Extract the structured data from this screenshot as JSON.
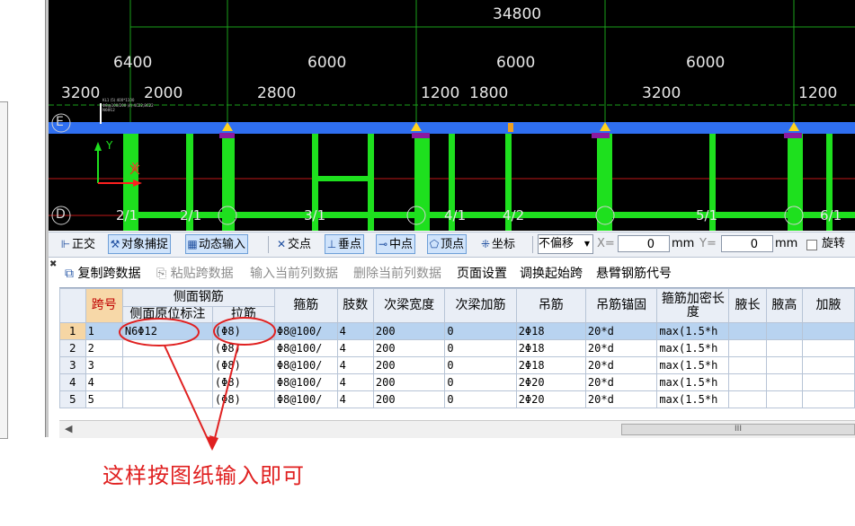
{
  "cad": {
    "total_dim": "34800",
    "upper_dims": [
      "6400",
      "6000",
      "6000",
      "6000"
    ],
    "lower_dims": [
      "3200",
      "2000",
      "2800",
      "1200",
      "1800",
      "3200",
      "1200"
    ],
    "axis_top": "E",
    "axis_bottom": "D",
    "span_labels": [
      "2/1",
      "2/1",
      "3/1",
      "4/1",
      "4/2",
      "5/1",
      "6/1"
    ],
    "ucs_y": "Y",
    "ucs_x": "X",
    "beam_color": "#2f6ff0",
    "rebar_color": "#1ee01e"
  },
  "toolbar": {
    "ortho": "正交",
    "snap": "对象捕捉",
    "dyninput": "动态输入",
    "intersect": "交点",
    "perp": "垂点",
    "mid": "中点",
    "vertex": "顶点",
    "coord": "坐标",
    "offset_select": "不偏移",
    "x_label": "X=",
    "x_value": "0",
    "mm1": "mm",
    "y_label": "Y=",
    "y_value": "0",
    "mm2": "mm",
    "rotate": "旋转"
  },
  "grid_toolbar": {
    "copy": "复制跨数据",
    "paste": "粘贴跨数据",
    "input_col": "输入当前列数据",
    "delete_col": "删除当前列数据",
    "page_setup": "页面设置",
    "swap_start": "调换起始跨",
    "cantilever": "悬臂钢筋代号"
  },
  "grid": {
    "headers": {
      "span": "跨号",
      "side_rebar": "侧面钢筋",
      "side_annot": "侧面原位标注",
      "tie": "拉筋",
      "stirrup": "箍筋",
      "legs": "肢数",
      "sec_width": "次梁宽度",
      "sec_add": "次梁加筋",
      "hanger": "吊筋",
      "hanger_anchor": "吊筋锚固",
      "dense_len": "箍筋加密长度",
      "haunch_len": "腋长",
      "haunch_h": "腋高",
      "extra": "加腋"
    },
    "rows": [
      {
        "n": "1",
        "span": "1",
        "side": "N6Φ12",
        "tie": "(Φ8)",
        "stirrup": "Φ8@100/",
        "legs": "4",
        "width": "200",
        "add": "0",
        "hanger": "2Φ18",
        "anchor": "20*d",
        "dense": "max(1.5*h"
      },
      {
        "n": "2",
        "span": "2",
        "side": "",
        "tie": "(Φ8)",
        "stirrup": "Φ8@100/",
        "legs": "4",
        "width": "200",
        "add": "0",
        "hanger": "2Φ18",
        "anchor": "20*d",
        "dense": "max(1.5*h"
      },
      {
        "n": "3",
        "span": "3",
        "side": "",
        "tie": "(Φ8)",
        "stirrup": "Φ8@100/",
        "legs": "4",
        "width": "200",
        "add": "0",
        "hanger": "2Φ18",
        "anchor": "20*d",
        "dense": "max(1.5*h"
      },
      {
        "n": "4",
        "span": "4",
        "side": "",
        "tie": "(Φ8)",
        "stirrup": "Φ8@100/",
        "legs": "4",
        "width": "200",
        "add": "0",
        "hanger": "2Φ20",
        "anchor": "20*d",
        "dense": "max(1.5*h"
      },
      {
        "n": "5",
        "span": "5",
        "side": "",
        "tie": "(Φ8)",
        "stirrup": "Φ8@100/",
        "legs": "4",
        "width": "200",
        "add": "0",
        "hanger": "2Φ20",
        "anchor": "20*d",
        "dense": "max(1.5*h"
      }
    ],
    "scroll_grip": "III"
  },
  "annotation": {
    "text": "这样按图纸输入即可",
    "color": "#e02020"
  }
}
